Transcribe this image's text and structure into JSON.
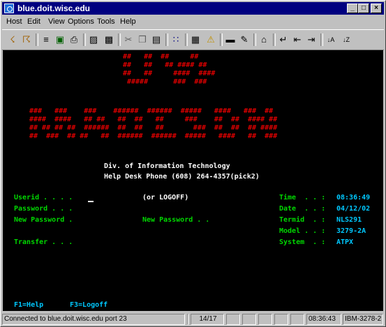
{
  "window": {
    "title": "blue.doit.wisc.edu"
  },
  "menu": [
    "Host",
    "Edit",
    "View",
    "Options",
    "Tools",
    "Help"
  ],
  "toolbar_icons": [
    "connect-icon",
    "disconnect-icon",
    "send-file-icon",
    "receive-file-icon",
    "print-icon",
    "capture-icon",
    "macro-icon",
    "cut-icon",
    "copy-icon",
    "paste-icon",
    "keypad-icon",
    "settings-icon",
    "alert-icon",
    "screen-icon",
    "edit-icon",
    "home-icon",
    "return-icon",
    "backtab-icon",
    "tab-icon",
    "sort-asc-icon",
    "sort-desc-icon"
  ],
  "logo_art": {
    "top": [
      "##   ##  ##     ##",
      "##   ##   ## #### ##",
      "##   ##     ####  ####",
      "#####      ###  ###"
    ],
    "bottom": [
      "###   ###    ###    ######  ######  #####   ####   ###  ##",
      "####  ####   ## ##   ##  ##   ##     ###    ##  ##  #### ##",
      "## ## ## ##  ######  ##  ##   ##       ###  ##  ##  ## ####",
      "##  ###  ## ##   ##  ######  ######  #####   ####   ##  ###"
    ]
  },
  "header": {
    "line1": "Div. of Information Technology",
    "line2": "Help Desk Phone (608) 264-4357(pick2)"
  },
  "form": {
    "userid": "Userid . . . .",
    "logoff_hint": "(or LOGOFF)",
    "password": "Password . . .",
    "new_password_left": "New Password .",
    "new_password_right": "New Password . .",
    "transfer": "Transfer . . ."
  },
  "info": {
    "time_label": "Time  . . :",
    "time_value": "08:36:49",
    "date_label": "Date  . . :",
    "date_value": "04/12/02",
    "termid_label": "Termid  . :",
    "termid_value": "NLS291",
    "model_label": "Model . . :",
    "model_value": "3279-2A",
    "system_label": "System  . :",
    "system_value": "ATPX"
  },
  "fkeys": {
    "f1": "F1=Help",
    "f3": "F3=Logoff"
  },
  "status": {
    "connection": "Connected to blue.doit.wisc.edu port 23",
    "cursor_pos": "14/17",
    "clock": "08:36:43",
    "terminal": "IBM-3278-2"
  }
}
